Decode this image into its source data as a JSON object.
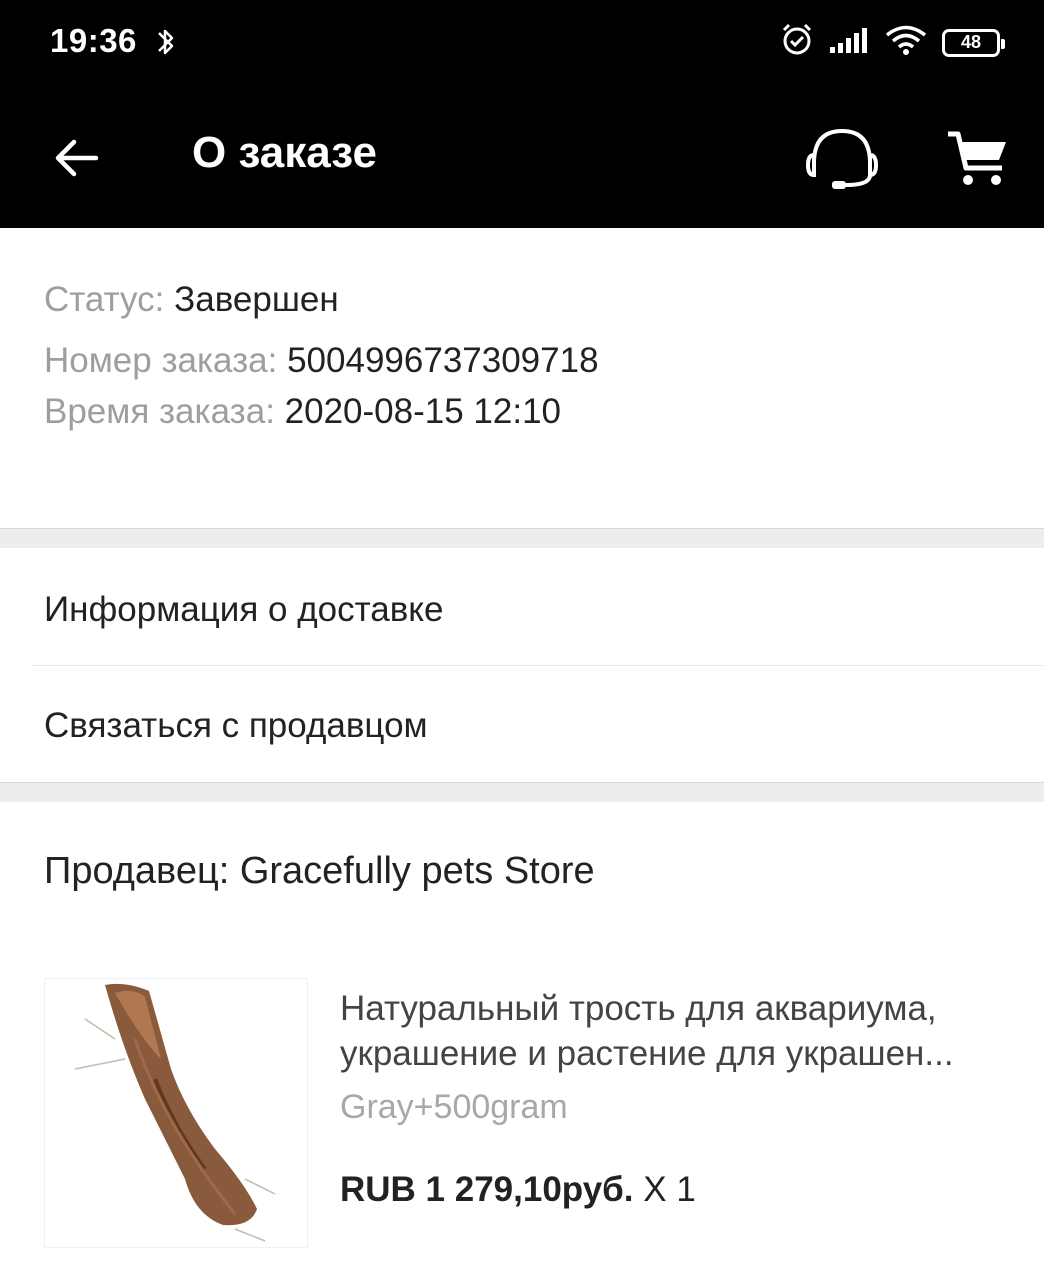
{
  "status_bar": {
    "time": "19:36",
    "battery": "48",
    "icons": [
      "bluetooth-icon",
      "alarm-icon",
      "signal-icon",
      "wifi-icon",
      "battery-icon"
    ]
  },
  "header": {
    "title": "О заказе",
    "icons": [
      "back-arrow-icon",
      "headset-icon",
      "cart-icon"
    ]
  },
  "order": {
    "status_label": "Статус: ",
    "status_value": "Завершен",
    "number_label": "Номер заказа: ",
    "number_value": "5004996737309718",
    "time_label": "Время заказа: ",
    "time_value": "2020-08-15 12:10"
  },
  "menu": {
    "delivery": "Информация о доставке",
    "contact_seller": "Связаться с продавцом"
  },
  "seller": {
    "label": "Продавец: Gracefully pets Store"
  },
  "product": {
    "title_line1": "Натуральный трость для аквариума,",
    "title_line2": "украшение и растение для украшен...",
    "variant": "Gray+500gram",
    "price": "RUB 1 279,10руб.",
    "quantity": " X 1"
  },
  "colors": {
    "bar_background": "#000000",
    "separator": "#ededed",
    "label_gray": "#9e9e9e"
  }
}
